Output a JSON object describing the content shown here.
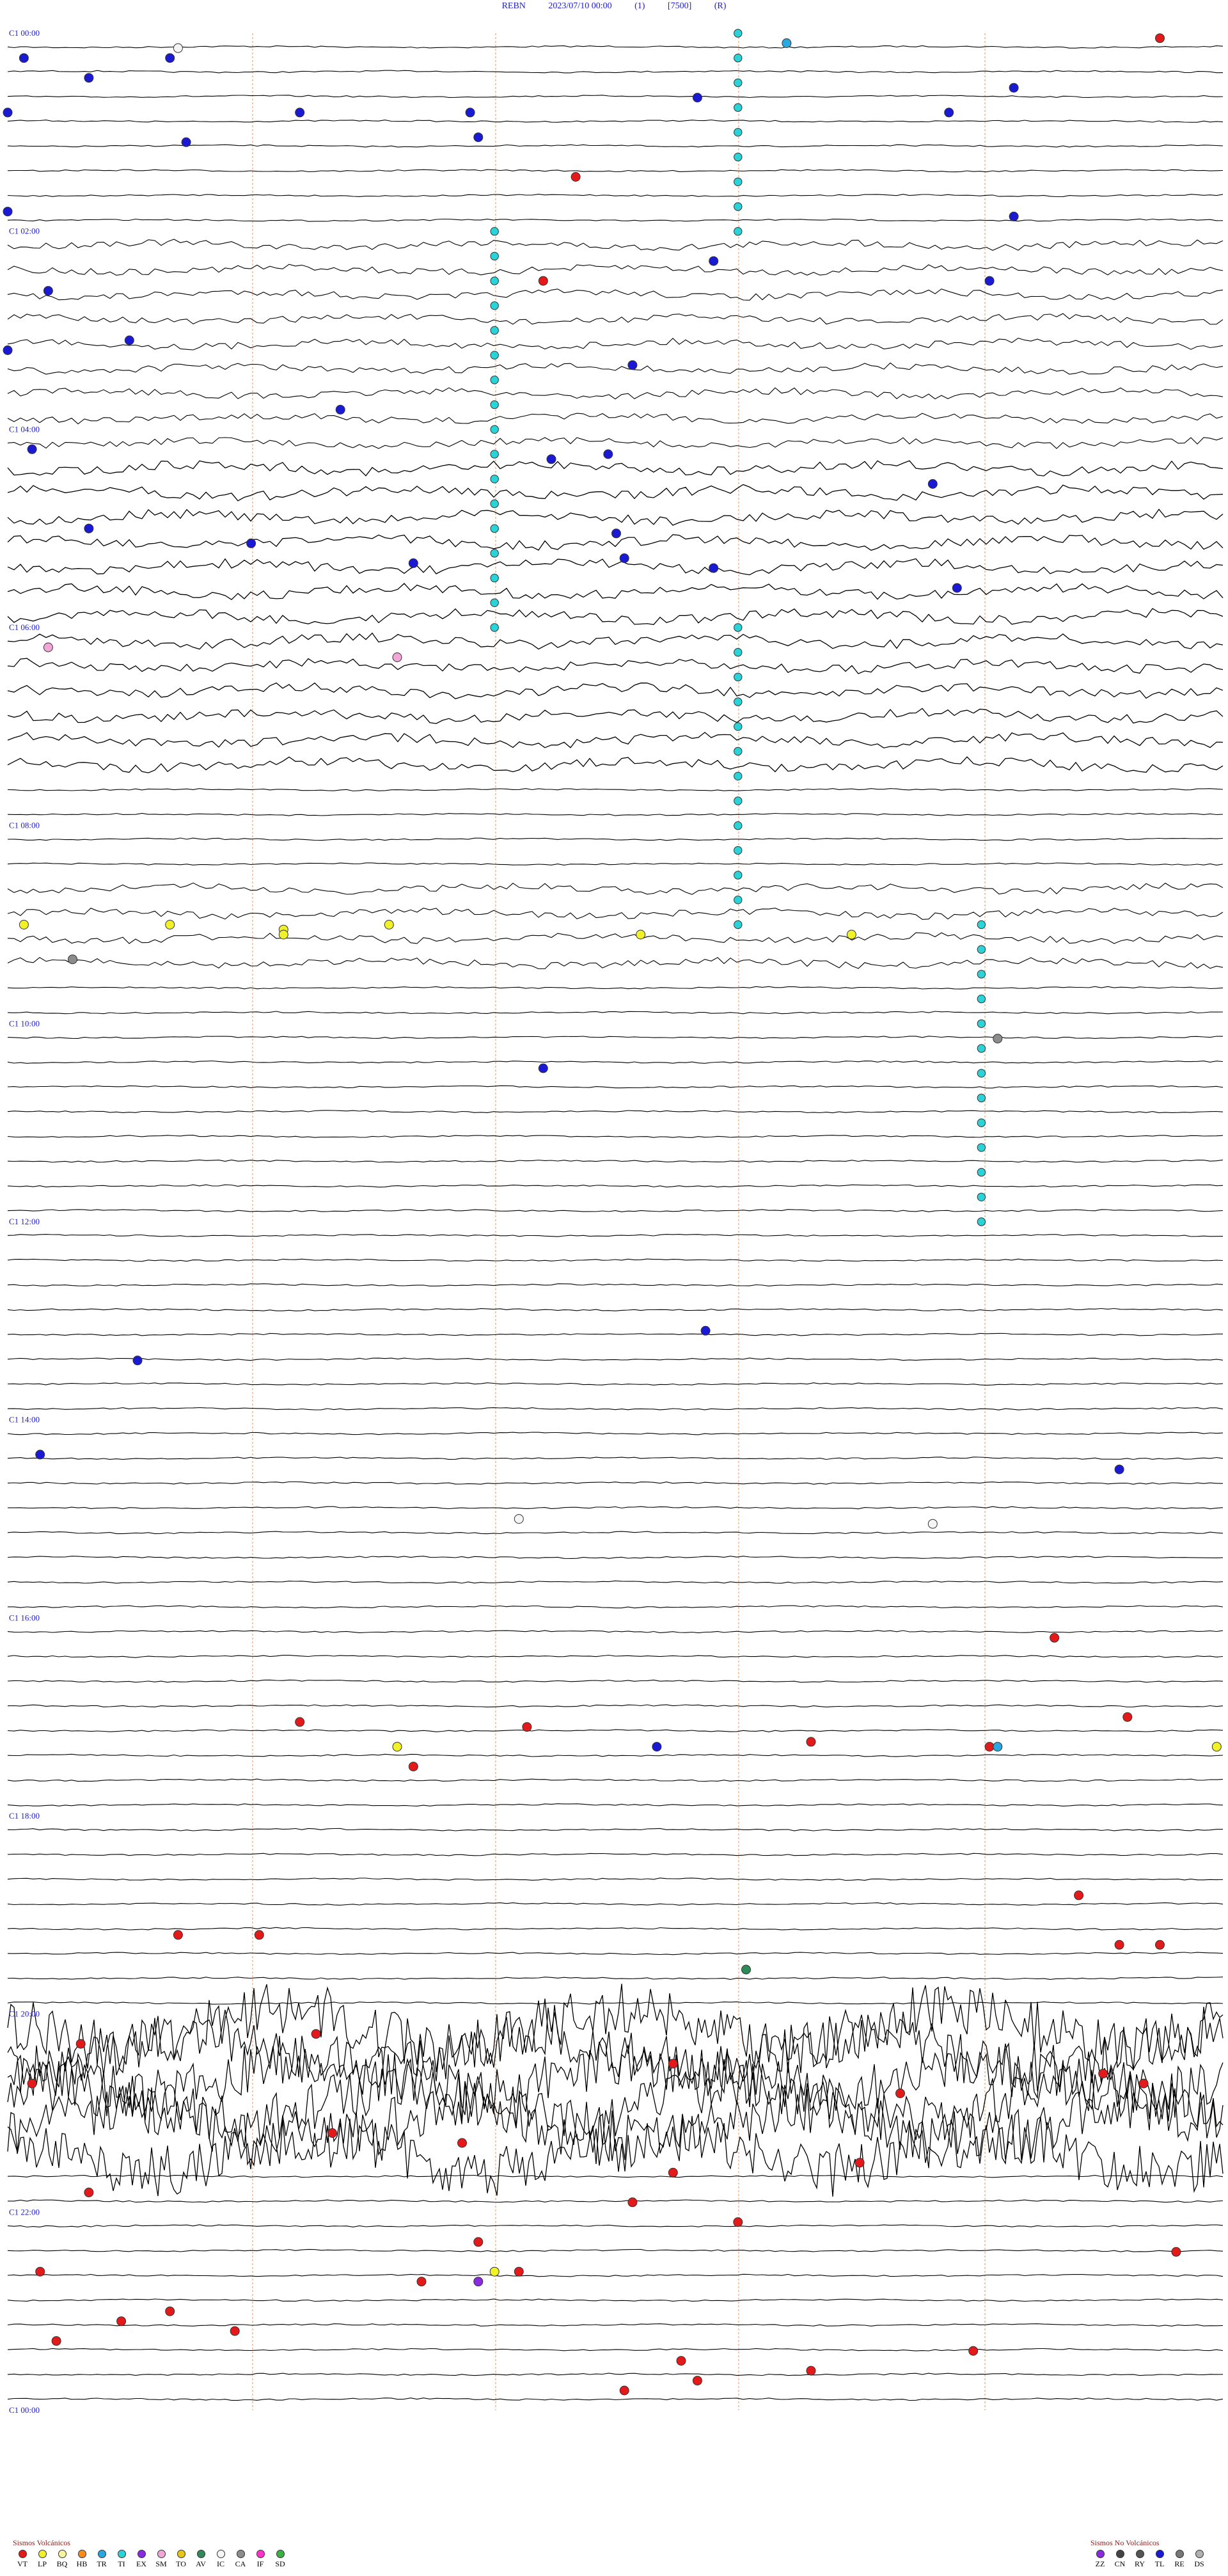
{
  "header": {
    "station": "REBN",
    "datetime": "2023/07/10 00:00",
    "channel": "(1)",
    "scale": "[7500]",
    "mode": "(R)"
  },
  "chart_data": {
    "type": "helicorder",
    "title": "REBN   2023/07/10 00:00   (1)   [7500]  (R)",
    "hour_labels": [
      "00:00",
      "02:00",
      "04:00",
      "06:00",
      "08:00",
      "10:00",
      "12:00",
      "14:00",
      "16:00",
      "18:00",
      "20:00",
      "22:00",
      "00:00"
    ],
    "traces_per_hour": 4,
    "total_hours": 24,
    "colors": {
      "trace": "#000000",
      "hour_label": "#1c1cc8",
      "minute_marker": "#d2691e",
      "TI_marker": "#29d3d8"
    },
    "ti_columns": [
      {
        "minute": 24,
        "from_hour": 0.0,
        "to_hour": 2.0
      },
      {
        "minute": 36,
        "from_hour": 2.0,
        "to_hour": 6.0
      },
      {
        "minute": 24,
        "from_hour": 6.0,
        "to_hour": 9.0
      },
      {
        "minute": 12,
        "from_hour": 9.0,
        "to_hour": 12.0
      }
    ],
    "events": [
      {
        "type": "VT",
        "hour": 0.05,
        "minute": 44.2
      },
      {
        "type": "TR",
        "hour": 0.1,
        "minute": 24.6
      },
      {
        "type": "IC",
        "hour": 0.15,
        "minute": 47.1
      },
      {
        "type": "TL",
        "hour": 0.25,
        "minute": 2.0
      },
      {
        "type": "TL",
        "hour": 0.25,
        "minute": 15.2
      },
      {
        "type": "TL",
        "hour": 0.45,
        "minute": 16.0
      },
      {
        "type": "TL",
        "hour": 0.55,
        "minute": 57.4
      },
      {
        "type": "TL",
        "hour": 0.65,
        "minute": 8.5
      },
      {
        "type": "TL",
        "hour": 0.8,
        "minute": 15.0
      },
      {
        "type": "TL",
        "hour": 0.8,
        "minute": 18.6
      },
      {
        "type": "TL",
        "hour": 0.8,
        "minute": 20.7
      },
      {
        "type": "TL",
        "hour": 0.8,
        "minute": 56.6
      },
      {
        "type": "TL",
        "hour": 1.05,
        "minute": 35.8
      },
      {
        "type": "TL",
        "hour": 1.1,
        "minute": 47.2
      },
      {
        "type": "VT",
        "hour": 1.45,
        "minute": 7.0
      },
      {
        "type": "TL",
        "hour": 1.8,
        "minute": 30.0
      },
      {
        "type": "TL",
        "hour": 1.85,
        "minute": 27.4
      },
      {
        "type": "TL",
        "hour": 2.3,
        "minute": 53.7
      },
      {
        "type": "VT",
        "hour": 2.5,
        "minute": 21.6
      },
      {
        "type": "TL",
        "hour": 2.5,
        "minute": 42.1
      },
      {
        "type": "TL",
        "hour": 2.6,
        "minute": 0.5
      },
      {
        "type": "TL",
        "hour": 3.1,
        "minute": 31.5
      },
      {
        "type": "TL",
        "hour": 3.2,
        "minute": 0.0
      },
      {
        "type": "TL",
        "hour": 3.35,
        "minute": 37.7
      },
      {
        "type": "TL",
        "hour": 3.8,
        "minute": 34.1
      },
      {
        "type": "TL",
        "hour": 4.2,
        "minute": 30.3
      },
      {
        "type": "TL",
        "hour": 4.25,
        "minute": 37.4
      },
      {
        "type": "TL",
        "hour": 4.3,
        "minute": 6.7
      },
      {
        "type": "TL",
        "hour": 4.55,
        "minute": 41.4
      },
      {
        "type": "TL",
        "hour": 5.0,
        "minute": 1.0
      },
      {
        "type": "TL",
        "hour": 5.05,
        "minute": 37.5
      },
      {
        "type": "TL",
        "hour": 5.15,
        "minute": 18.0
      },
      {
        "type": "TL",
        "hour": 5.3,
        "minute": 7.6
      },
      {
        "type": "TL",
        "hour": 5.35,
        "minute": 20.0
      },
      {
        "type": "TL",
        "hour": 5.4,
        "minute": 38.7
      },
      {
        "type": "TL",
        "hour": 5.6,
        "minute": 56.7
      },
      {
        "type": "SM",
        "hour": 6.2,
        "minute": 30.5
      },
      {
        "type": "SM",
        "hour": 6.3,
        "minute": 19.8
      },
      {
        "type": "LP",
        "hour": 9.0,
        "minute": 17.0
      },
      {
        "type": "LP",
        "hour": 9.05,
        "minute": 18.4
      },
      {
        "type": "LP",
        "hour": 9.1,
        "minute": 22.8
      },
      {
        "type": "LP",
        "hour": 9.0,
        "minute": 34.7
      },
      {
        "type": "LP",
        "hour": 9.0,
        "minute": 45.2
      },
      {
        "type": "LP",
        "hour": 9.1,
        "minute": 33.4
      },
      {
        "type": "LP",
        "hour": 9.1,
        "minute": 55.4
      },
      {
        "type": "CA",
        "hour": 9.35,
        "minute": 15.8
      },
      {
        "type": "CA",
        "hour": 10.15,
        "minute": 12.2
      },
      {
        "type": "TL",
        "hour": 10.45,
        "minute": 6.6
      },
      {
        "type": "TL",
        "hour": 13.1,
        "minute": 23.6
      },
      {
        "type": "TL",
        "hour": 13.4,
        "minute": 1.6
      },
      {
        "type": "TL",
        "hour": 14.35,
        "minute": 30.4
      },
      {
        "type": "TL",
        "hour": 14.5,
        "minute": 43.7
      },
      {
        "type": "IC",
        "hour": 15.05,
        "minute": 26.4
      },
      {
        "type": "IC",
        "hour": 15.0,
        "minute": 36.3
      },
      {
        "type": "VT",
        "hour": 16.2,
        "minute": 57.9
      },
      {
        "type": "VT",
        "hour": 17.0,
        "minute": 28.8
      },
      {
        "type": "VT",
        "hour": 17.05,
        "minute": 3.6
      },
      {
        "type": "VT",
        "hour": 17.1,
        "minute": 51.4
      },
      {
        "type": "VT",
        "hour": 17.25,
        "minute": 9.9
      },
      {
        "type": "TL",
        "hour": 17.3,
        "minute": 8.0
      },
      {
        "type": "VT",
        "hour": 17.3,
        "minute": 27.1
      },
      {
        "type": "LP",
        "hour": 17.3,
        "minute": 29.9
      },
      {
        "type": "LP",
        "hour": 17.3,
        "minute": 34.8
      },
      {
        "type": "TR",
        "hour": 17.3,
        "minute": 42.2
      },
      {
        "type": "VT",
        "hour": 17.5,
        "minute": 5.0
      },
      {
        "type": "VT",
        "hour": 18.8,
        "minute": 58.2
      },
      {
        "type": "VT",
        "hour": 19.2,
        "minute": 32.1
      },
      {
        "type": "VT",
        "hour": 19.2,
        "minute": 33.1
      },
      {
        "type": "VT",
        "hour": 19.3,
        "minute": 43.7
      },
      {
        "type": "VT",
        "hour": 19.3,
        "minute": 44.2
      },
      {
        "type": "AV",
        "hour": 19.55,
        "minute": 39.1
      },
      {
        "type": "VT",
        "hour": 20.2,
        "minute": 3.8
      },
      {
        "type": "VT",
        "hour": 20.3,
        "minute": 15.9
      },
      {
        "type": "VT",
        "hour": 20.5,
        "minute": 23.2
      },
      {
        "type": "VT",
        "hour": 20.6,
        "minute": 28.5
      },
      {
        "type": "VT",
        "hour": 20.7,
        "minute": 44.0
      },
      {
        "type": "VT",
        "hour": 20.7,
        "minute": 45.3
      },
      {
        "type": "VT",
        "hour": 20.8,
        "minute": 56.0
      },
      {
        "type": "VT",
        "hour": 21.2,
        "minute": 4.0
      },
      {
        "type": "VT",
        "hour": 21.3,
        "minute": 20.6
      },
      {
        "type": "VT",
        "hour": 21.5,
        "minute": 25.5
      },
      {
        "type": "VT",
        "hour": 21.6,
        "minute": 38.2
      },
      {
        "type": "VT",
        "hour": 21.8,
        "minute": 46.0
      },
      {
        "type": "VT",
        "hour": 21.9,
        "minute": 52.7
      },
      {
        "type": "VT",
        "hour": 22.1,
        "minute": 9.0
      },
      {
        "type": "VT",
        "hour": 22.3,
        "minute": 20.8
      },
      {
        "type": "VT",
        "hour": 22.4,
        "minute": 29.4
      },
      {
        "type": "VT",
        "hour": 22.6,
        "minute": 36.3
      },
      {
        "type": "VT",
        "hour": 22.6,
        "minute": 45.4
      },
      {
        "type": "VT",
        "hour": 22.7,
        "minute": 50.1
      },
      {
        "type": "EX",
        "hour": 22.7,
        "minute": 35.8
      },
      {
        "type": "LP",
        "hour": 22.6,
        "minute": 6.0
      },
      {
        "type": "VT",
        "hour": 23.0,
        "minute": 2.0
      },
      {
        "type": "VT",
        "hour": 23.1,
        "minute": 16.4
      },
      {
        "type": "VT",
        "hour": 23.2,
        "minute": 32.8
      },
      {
        "type": "VT",
        "hour": 23.3,
        "minute": 45.6
      },
      {
        "type": "VT",
        "hour": 23.4,
        "minute": 56.9
      },
      {
        "type": "VT",
        "hour": 23.5,
        "minute": 8.3
      },
      {
        "type": "VT",
        "hour": 23.6,
        "minute": 24.9
      },
      {
        "type": "VT",
        "hour": 23.7,
        "minute": 38.5
      },
      {
        "type": "VT",
        "hour": 23.8,
        "minute": 52.6
      }
    ],
    "noise_episodes": [
      {
        "from_hour": 2.0,
        "to_hour": 4.2,
        "level": 2
      },
      {
        "from_hour": 4.2,
        "to_hour": 7.5,
        "level": 3
      },
      {
        "from_hour": 8.3,
        "to_hour": 9.4,
        "level": 2
      },
      {
        "from_hour": 20.0,
        "to_hour": 21.3,
        "level": 5
      }
    ]
  },
  "legend": {
    "volcanic_title": "Sismos Volcánicos",
    "volcanic": [
      {
        "code": "VT",
        "color": "#e41a1a"
      },
      {
        "code": "LP",
        "color": "#f1f128"
      },
      {
        "code": "BQ",
        "color": "#f5f5a0"
      },
      {
        "code": "HB",
        "color": "#ff8c1a"
      },
      {
        "code": "TR",
        "color": "#2ba7e0"
      },
      {
        "code": "TI",
        "color": "#29d3d8"
      },
      {
        "code": "EX",
        "color": "#8a2be2"
      },
      {
        "code": "SM",
        "color": "#f2a6d8"
      },
      {
        "code": "TO",
        "color": "#e6c619"
      },
      {
        "code": "AV",
        "color": "#2e8b57"
      },
      {
        "code": "IC",
        "color": "#f5f5f5"
      },
      {
        "code": "CA",
        "color": "#8c8c8c"
      },
      {
        "code": "IF",
        "color": "#ff33cc"
      },
      {
        "code": "SD",
        "color": "#3cb043"
      }
    ],
    "nonvolcanic_title": "Sismos No Volcánicos",
    "nonvolcanic": [
      {
        "code": "ZZ",
        "color": "#8a2be2"
      },
      {
        "code": "CN",
        "color": "#444444"
      },
      {
        "code": "RY",
        "color": "#555555"
      },
      {
        "code": "TL",
        "color": "#1a1ad4"
      },
      {
        "code": "RE",
        "color": "#777777"
      },
      {
        "code": "DS",
        "color": "#b0b0b0"
      }
    ]
  }
}
